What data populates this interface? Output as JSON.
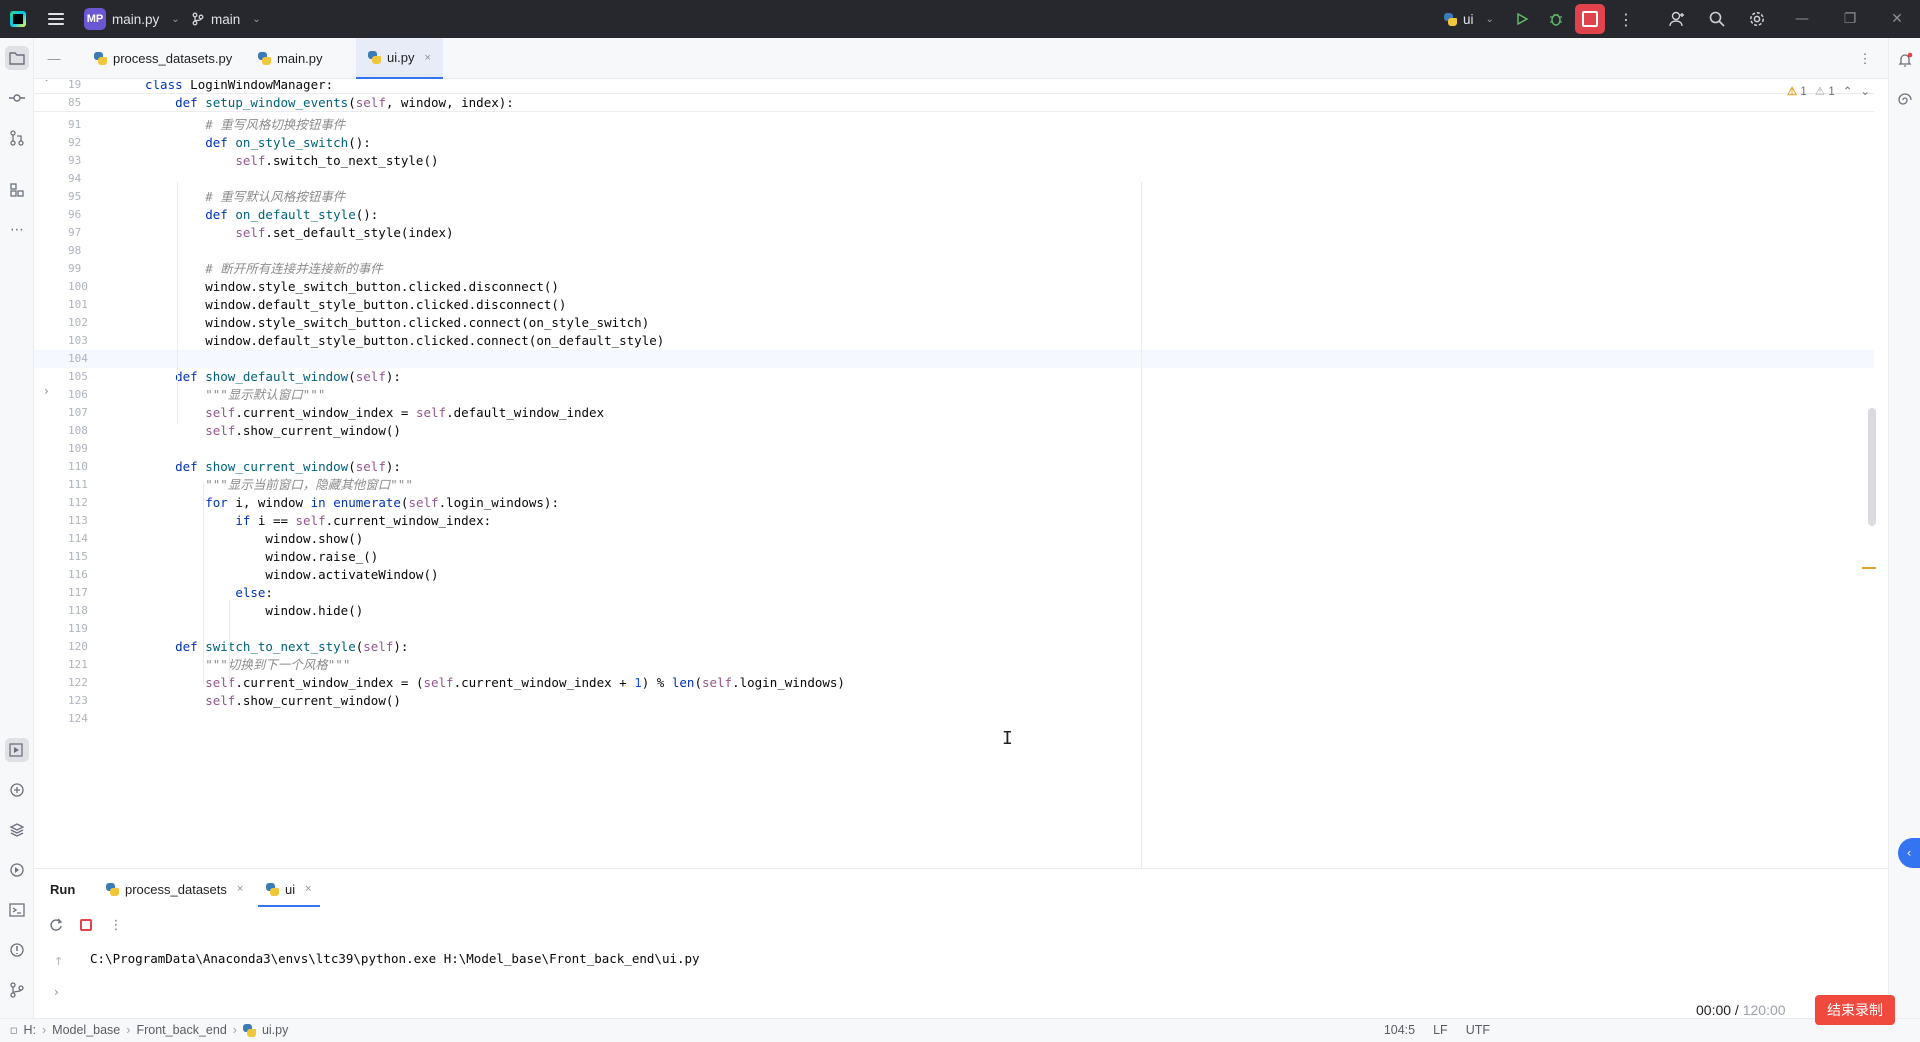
{
  "titlebar": {
    "project_badge": "MP",
    "project_name": "main.py",
    "branch": "main",
    "run_config": "ui"
  },
  "tabs": [
    {
      "label": "process_datasets.py"
    },
    {
      "label": "main.py"
    },
    {
      "label": "ui.py",
      "close": "×"
    }
  ],
  "inspections": {
    "warnings": "1",
    "weak_warnings": "1"
  },
  "code": {
    "sticky": [
      {
        "num": "19",
        "text": "class LoginWindowManager:"
      },
      {
        "num": "85",
        "text": "    def setup_window_events(self, window, index):"
      }
    ],
    "lines": [
      {
        "num": "91",
        "text": "        # 重写风格切换按钮事件"
      },
      {
        "num": "92",
        "text": "        def on_style_switch():"
      },
      {
        "num": "93",
        "text": "            self.switch_to_next_style()"
      },
      {
        "num": "94",
        "text": ""
      },
      {
        "num": "95",
        "text": "        # 重写默认风格按钮事件"
      },
      {
        "num": "96",
        "text": "        def on_default_style():"
      },
      {
        "num": "97",
        "text": "            self.set_default_style(index)"
      },
      {
        "num": "98",
        "text": ""
      },
      {
        "num": "99",
        "text": "        # 断开所有连接并连接新的事件"
      },
      {
        "num": "100",
        "text": "        window.style_switch_button.clicked.disconnect()"
      },
      {
        "num": "101",
        "text": "        window.default_style_button.clicked.disconnect()"
      },
      {
        "num": "102",
        "text": "        window.style_switch_button.clicked.connect(on_style_switch)"
      },
      {
        "num": "103",
        "text": "        window.default_style_button.clicked.connect(on_default_style)"
      },
      {
        "num": "104",
        "text": ""
      },
      {
        "num": "105",
        "text": "    def show_default_window(self):"
      },
      {
        "num": "106",
        "text": "        \"\"\"显示默认窗口\"\"\""
      },
      {
        "num": "107",
        "text": "        self.current_window_index = self.default_window_index"
      },
      {
        "num": "108",
        "text": "        self.show_current_window()"
      },
      {
        "num": "109",
        "text": ""
      },
      {
        "num": "110",
        "text": "    def show_current_window(self):"
      },
      {
        "num": "111",
        "text": "        \"\"\"显示当前窗口，隐藏其他窗口\"\"\""
      },
      {
        "num": "112",
        "text": "        for i, window in enumerate(self.login_windows):"
      },
      {
        "num": "113",
        "text": "            if i == self.current_window_index:"
      },
      {
        "num": "114",
        "text": "                window.show()"
      },
      {
        "num": "115",
        "text": "                window.raise_()"
      },
      {
        "num": "116",
        "text": "                window.activateWindow()"
      },
      {
        "num": "117",
        "text": "            else:"
      },
      {
        "num": "118",
        "text": "                window.hide()"
      },
      {
        "num": "119",
        "text": ""
      },
      {
        "num": "120",
        "text": "    def switch_to_next_style(self):"
      },
      {
        "num": "121",
        "text": "        \"\"\"切换到下一个风格\"\"\""
      },
      {
        "num": "122",
        "text": "        self.current_window_index = (self.current_window_index + 1) % len(self.login_windows)"
      },
      {
        "num": "123",
        "text": "        self.show_current_window()"
      },
      {
        "num": "124",
        "text": ""
      }
    ],
    "current_line": "104"
  },
  "run_panel": {
    "title": "Run",
    "tabs": [
      {
        "label": "process_datasets",
        "close": "×"
      },
      {
        "label": "ui",
        "close": "×"
      }
    ],
    "console": "C:\\ProgramData\\Anaconda3\\envs\\ltc39\\python.exe H:\\Model_base\\Front_back_end\\ui.py"
  },
  "statusbar": {
    "crumbs": [
      "H:",
      "Model_base",
      "Front_back_end",
      "ui.py"
    ],
    "position": "104:5",
    "line_sep": "LF",
    "encoding": "UTF"
  },
  "recording": {
    "elapsed": "00:00",
    "sep": " / ",
    "total": "120:00",
    "stop_label": "结束录制"
  },
  "colors": {
    "accent": "#3574f0",
    "stop_red": "#e0434b",
    "record_red": "#f04a3e",
    "titlebar_bg": "#27282e"
  }
}
